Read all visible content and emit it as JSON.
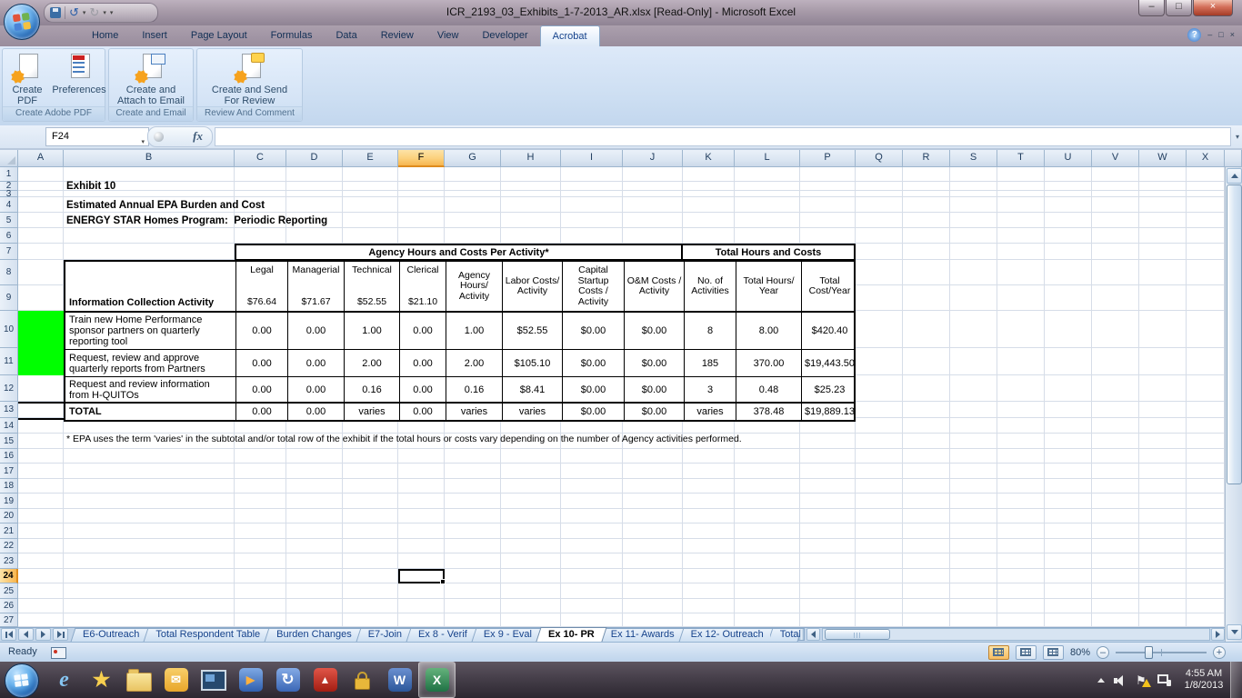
{
  "title_bar": {
    "title": "ICR_2193_03_Exhibits_1-7-2013_AR.xlsx  [Read-Only] - Microsoft Excel"
  },
  "ribbon": {
    "tabs": [
      "Home",
      "Insert",
      "Page Layout",
      "Formulas",
      "Data",
      "Review",
      "View",
      "Developer",
      "Acrobat"
    ],
    "active_tab": "Acrobat",
    "groups": [
      {
        "label": "Create Adobe PDF",
        "buttons": [
          {
            "label": "Create\nPDF"
          },
          {
            "label": "Preferences"
          }
        ]
      },
      {
        "label": "Create and Email",
        "buttons": [
          {
            "label": "Create and\nAttach to Email"
          }
        ]
      },
      {
        "label": "Review And Comment",
        "buttons": [
          {
            "label": "Create and Send\nFor Review"
          }
        ]
      }
    ]
  },
  "formula_bar": {
    "name_box": "F24",
    "fx_label": "fx",
    "formula_value": ""
  },
  "grid": {
    "columns": [
      "A",
      "B",
      "C",
      "D",
      "E",
      "F",
      "G",
      "H",
      "I",
      "J",
      "K",
      "L",
      "P",
      "Q",
      "R",
      "S",
      "T",
      "U",
      "V",
      "W",
      "X"
    ],
    "row_start": 1,
    "row_end": 27,
    "selected_column": "F",
    "selected_row": 24,
    "active_cell": "F24",
    "highlight_color": "#00ff00"
  },
  "sheet": {
    "exhibit_label": "Exhibit 10",
    "subtitle1": "Estimated Annual EPA Burden and Cost",
    "subtitle2": "ENERGY STAR Homes Program:  Periodic Reporting",
    "table": {
      "band_left": "Agency Hours and Costs Per Activity*",
      "band_right": "Total Hours and Costs",
      "row_header": "Information Collection Activity",
      "columns": [
        {
          "label": "Legal",
          "rate": "$76.64"
        },
        {
          "label": "Managerial",
          "rate": "$71.67"
        },
        {
          "label": "Technical",
          "rate": "$52.55"
        },
        {
          "label": "Clerical",
          "rate": "$21.10"
        },
        {
          "label": "Agency Hours/ Activity"
        },
        {
          "label": "Labor Costs/ Activity"
        },
        {
          "label": "Capital Startup Costs / Activity"
        },
        {
          "label": "O&M Costs / Activity"
        },
        {
          "label": "No. of Activities"
        },
        {
          "label": "Total Hours/ Year"
        },
        {
          "label": "Total Cost/Year"
        }
      ],
      "rows": [
        {
          "activity": "Train new Home Performance sponsor partners on quarterly reporting tool",
          "values": [
            "0.00",
            "0.00",
            "1.00",
            "0.00",
            "1.00",
            "$52.55",
            "$0.00",
            "$0.00",
            "8",
            "8.00",
            "$420.40"
          ]
        },
        {
          "activity": "Request, review and approve quarterly reports from Partners",
          "values": [
            "0.00",
            "0.00",
            "2.00",
            "0.00",
            "2.00",
            "$105.10",
            "$0.00",
            "$0.00",
            "185",
            "370.00",
            "$19,443.50"
          ]
        },
        {
          "activity": "Request and review information from H-QUITOs",
          "values": [
            "0.00",
            "0.00",
            "0.16",
            "0.00",
            "0.16",
            "$8.41",
            "$0.00",
            "$0.00",
            "3",
            "0.48",
            "$25.23"
          ]
        }
      ],
      "total": {
        "activity": "TOTAL",
        "values": [
          "0.00",
          "0.00",
          "varies",
          "0.00",
          "varies",
          "varies",
          "$0.00",
          "$0.00",
          "varies",
          "378.48",
          "$19,889.13"
        ]
      }
    },
    "footnote": "* EPA uses the term 'varies' in the subtotal and/or total row of the exhibit if the total hours or costs vary depending on the number of Agency activities performed."
  },
  "sheet_tabs": {
    "tabs": [
      "E6-Outreach",
      "Total Respondent Table",
      "Burden Changes",
      "E7-Join",
      "Ex 8 - Verif",
      "Ex 9 - Eval",
      "Ex 10- PR",
      "Ex 11- Awards",
      "Ex 12- Outreach",
      "Total"
    ],
    "active": "Ex 10- PR"
  },
  "status_bar": {
    "mode": "Ready",
    "zoom_level": "80%"
  },
  "taskbar": {
    "icons": [
      "internet-explorer",
      "favorites-star",
      "windows-explorer",
      "outlook",
      "app-window",
      "media-player",
      "sync-center",
      "adobe-reader",
      "credential-manager",
      "word",
      "excel"
    ],
    "active_icon": "excel",
    "tray": {
      "time": "4:55 AM",
      "date": "1/8/2013"
    }
  }
}
